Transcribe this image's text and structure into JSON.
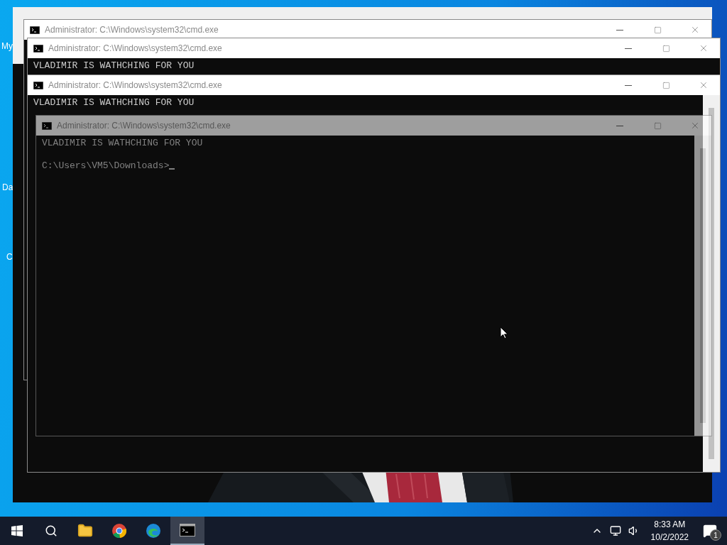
{
  "desktop_icons": [
    {
      "label": "My"
    },
    {
      "label": "Da"
    },
    {
      "label": "C"
    }
  ],
  "windows": [
    {
      "title": "Administrator: C:\\Windows\\system32\\cmd.exe",
      "ghost": false,
      "scrollbar": false
    },
    {
      "title": "Administrator: C:\\Windows\\system32\\cmd.exe",
      "output": "VLADIMIR IS WATHCHING FOR YOU",
      "ghost": false,
      "scrollbar": false
    },
    {
      "title": "Administrator: C:\\Windows\\system32\\cmd.exe",
      "output": "VLADIMIR IS WATHCHING FOR YOU",
      "ghost": false,
      "scrollbar": true
    },
    {
      "title": "Administrator: C:\\Windows\\system32\\cmd.exe",
      "output": "VLADIMIR IS WATHCHING FOR YOU",
      "prompt": "C:\\Users\\VM5\\Downloads>",
      "ghost": true,
      "scrollbar": true,
      "cursor": true
    }
  ],
  "taskbar": {
    "apps": [
      {
        "kind": "start",
        "active": false
      },
      {
        "kind": "search",
        "active": false
      },
      {
        "kind": "explorer",
        "active": false
      },
      {
        "kind": "chrome",
        "active": false
      },
      {
        "kind": "edge",
        "active": false
      },
      {
        "kind": "terminal",
        "active": true
      }
    ],
    "time": "8:33 AM",
    "date": "10/2/2022",
    "notifications": "1"
  }
}
